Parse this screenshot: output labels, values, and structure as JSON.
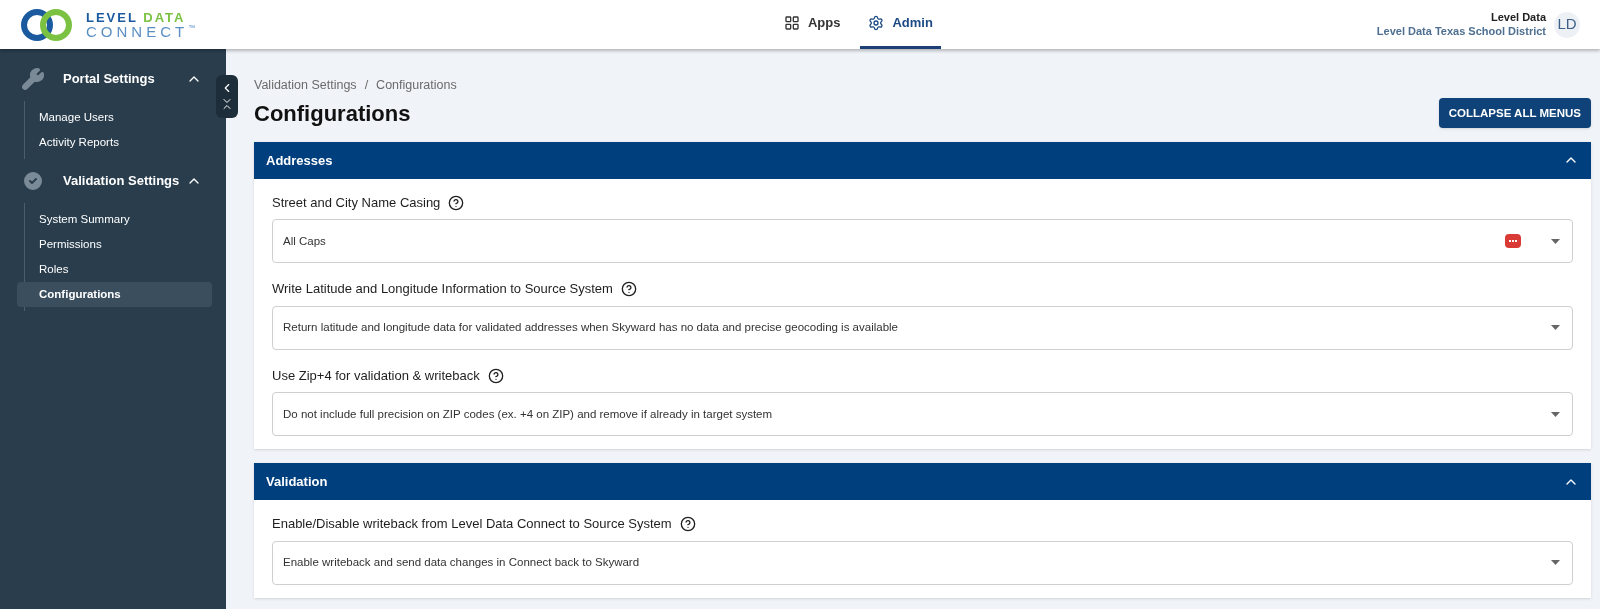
{
  "logo": {
    "line_1a": "LEVEL",
    "line_1b": "DATA",
    "line_2": "CONNECT",
    "mark": "™"
  },
  "nav": [
    {
      "label": "Apps",
      "kind": "apps",
      "selected": false
    },
    {
      "label": "Admin",
      "kind": "admin",
      "selected": true
    }
  ],
  "user": {
    "name": "Level Data",
    "org": "Level Data Texas School District",
    "initials": "LD"
  },
  "sidebar": {
    "groups": [
      {
        "label": "Portal Settings",
        "kind": "wrench",
        "expanded": true,
        "items": [
          {
            "label": "Manage Users",
            "selected": false
          },
          {
            "label": "Activity Reports",
            "selected": false
          }
        ]
      },
      {
        "label": "Validation Settings",
        "kind": "check",
        "expanded": true,
        "items": [
          {
            "label": "System Summary",
            "selected": false
          },
          {
            "label": "Permissions",
            "selected": false
          },
          {
            "label": "Roles",
            "selected": false
          },
          {
            "label": "Configurations",
            "selected": true
          }
        ]
      }
    ]
  },
  "breadcrumb": [
    "Validation Settings",
    "Configurations"
  ],
  "breadcrumb_separator": "/",
  "title": "Configurations",
  "collapse_button": "COLLAPSE ALL MENUS",
  "sections": [
    {
      "title": "Addresses",
      "expanded": true,
      "fields": [
        {
          "label": "Street and City Name Casing",
          "value": "All Caps",
          "password_badge": true
        },
        {
          "label": "Write Latitude and Longitude Information to Source System",
          "value": "Return latitude and longitude data for validated addresses when Skyward has no data and precise geocoding is available",
          "password_badge": false
        },
        {
          "label": "Use Zip+4 for validation & writeback",
          "value": "Do not include full precision on ZIP codes (ex. +4 on ZIP) and remove if already in target system",
          "password_badge": false
        }
      ]
    },
    {
      "title": "Validation",
      "expanded": true,
      "fields": [
        {
          "label": "Enable/Disable writeback from Level Data Connect to Source System",
          "value": "Enable writeback and send data changes in Connect back to Skyward",
          "password_badge": false
        }
      ]
    }
  ]
}
